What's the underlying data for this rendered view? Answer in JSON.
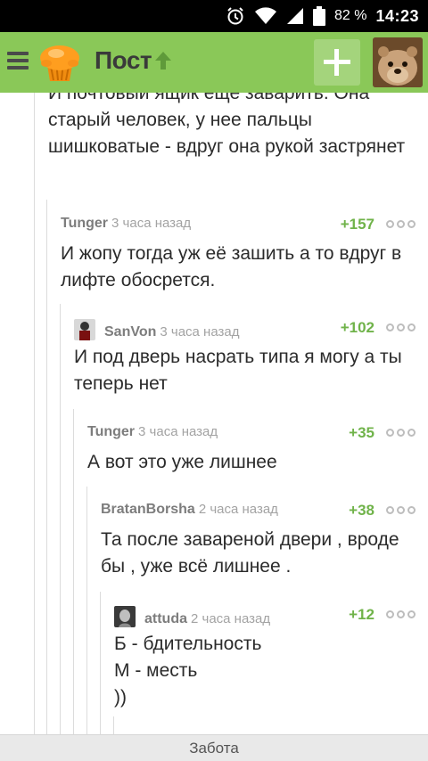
{
  "status_bar": {
    "battery_percent": "82 %",
    "time": "14:23"
  },
  "app_bar": {
    "title": "Пост"
  },
  "continuation_text": "И почтовый ящик еще заварить. Она старый человек, у нее пальцы шишковатые - вдруг она рукой застрянет",
  "comments": [
    {
      "author": "Tunger",
      "time": "3 часа назад",
      "rating": "+157",
      "body": "И жопу тогда уж её зашить а то вдруг в лифте обосрется.",
      "has_avatar": false
    },
    {
      "author": "SanVon",
      "time": "3 часа назад",
      "rating": "+102",
      "body": "И под дверь насрать типа я могу а ты теперь нет",
      "has_avatar": true
    },
    {
      "author": "Tunger",
      "time": "3 часа назад",
      "rating": "+35",
      "body": "А вот это уже лишнее",
      "has_avatar": false
    },
    {
      "author": "BratanBorsha",
      "time": "2 часа назад",
      "rating": "+38",
      "body": "Та после завареной двери , вроде бы , уже всё лишнее .",
      "has_avatar": false
    },
    {
      "author": "attuda",
      "time": "2 часа назад",
      "rating": "+12",
      "body": "Б - бдительность\nМ - месть\n))",
      "has_avatar": true
    }
  ],
  "bottom_bar": {
    "label": "Забота"
  },
  "colors": {
    "app_bar": "#8ac858",
    "rating": "#70b34a"
  }
}
